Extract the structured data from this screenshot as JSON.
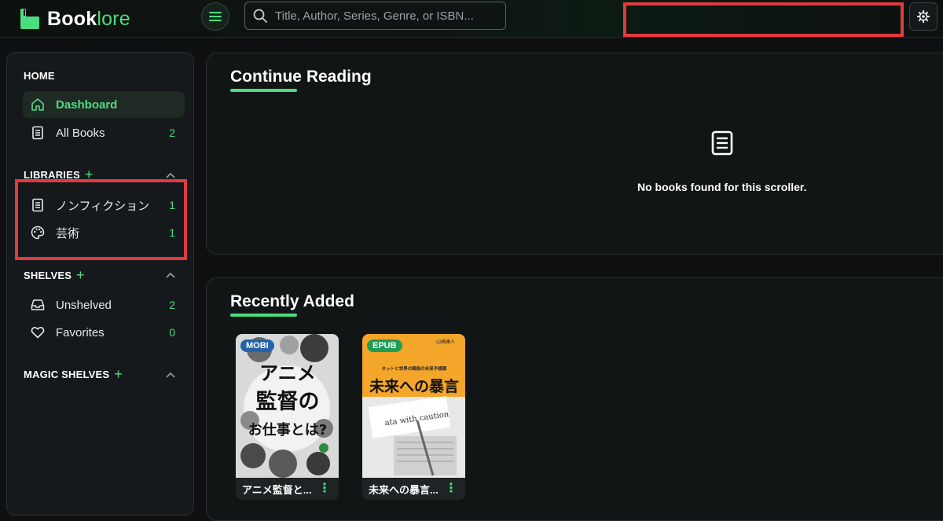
{
  "app": {
    "name_main": "Book",
    "name_accent": "lore"
  },
  "search": {
    "placeholder": "Title, Author, Series, Genre, or ISBN..."
  },
  "sidebar": {
    "home_heading": "HOME",
    "home_items": [
      {
        "label": "Dashboard",
        "icon": "home-icon"
      },
      {
        "label": "All Books",
        "icon": "book-icon",
        "count": "2"
      }
    ],
    "libraries_heading": "LIBRARIES",
    "libraries": [
      {
        "label": "ノンフィクション",
        "icon": "book-icon",
        "count": "1"
      },
      {
        "label": "芸術",
        "icon": "palette-icon",
        "count": "1"
      }
    ],
    "shelves_heading": "SHELVES",
    "shelves": [
      {
        "label": "Unshelved",
        "icon": "inbox-icon",
        "count": "2"
      },
      {
        "label": "Favorites",
        "icon": "heart-icon",
        "count": "0"
      }
    ],
    "magic_heading": "MAGIC SHELVES"
  },
  "continue_reading": {
    "title": "Continue Reading",
    "empty_text": "No books found for this scroller."
  },
  "recently_added": {
    "title": "Recently Added",
    "books": [
      {
        "format": "MOBI",
        "title": "アニメ監督と...",
        "cover_text": [
          "アニメ",
          "監督の",
          "お仕事とは?"
        ]
      },
      {
        "format": "EPUB",
        "title": "未来への暴言...",
        "cover_text": [
          "山崎達人",
          "ネットと世界の関係の未来予想図",
          "未来への暴言",
          "ata with caution"
        ]
      }
    ]
  },
  "colors": {
    "accent": "#4ade80",
    "highlight": "#e23a3f",
    "mobi_badge": "#2563a8",
    "epub_badge": "#1f9d55"
  }
}
